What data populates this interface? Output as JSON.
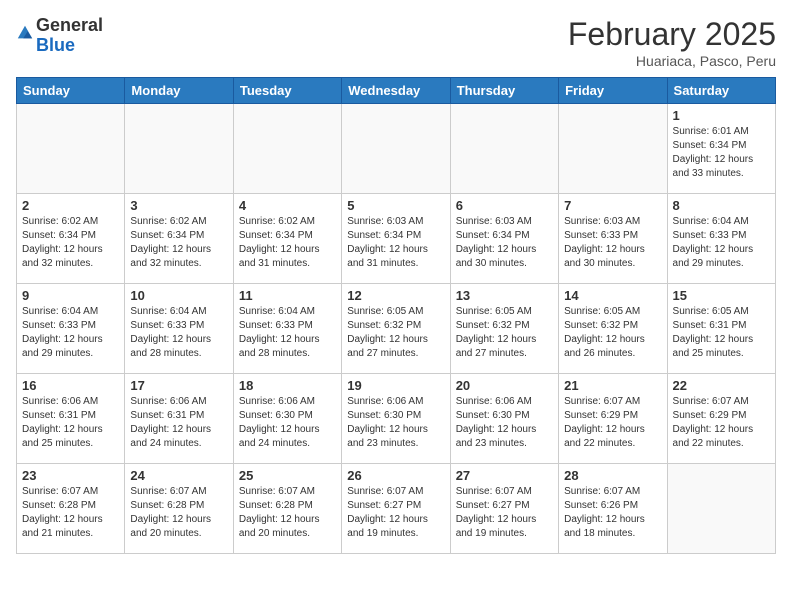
{
  "header": {
    "logo_general": "General",
    "logo_blue": "Blue",
    "month_title": "February 2025",
    "location": "Huariaca, Pasco, Peru"
  },
  "weekdays": [
    "Sunday",
    "Monday",
    "Tuesday",
    "Wednesday",
    "Thursday",
    "Friday",
    "Saturday"
  ],
  "weeks": [
    [
      {
        "day": "",
        "info": ""
      },
      {
        "day": "",
        "info": ""
      },
      {
        "day": "",
        "info": ""
      },
      {
        "day": "",
        "info": ""
      },
      {
        "day": "",
        "info": ""
      },
      {
        "day": "",
        "info": ""
      },
      {
        "day": "1",
        "info": "Sunrise: 6:01 AM\nSunset: 6:34 PM\nDaylight: 12 hours\nand 33 minutes."
      }
    ],
    [
      {
        "day": "2",
        "info": "Sunrise: 6:02 AM\nSunset: 6:34 PM\nDaylight: 12 hours\nand 32 minutes."
      },
      {
        "day": "3",
        "info": "Sunrise: 6:02 AM\nSunset: 6:34 PM\nDaylight: 12 hours\nand 32 minutes."
      },
      {
        "day": "4",
        "info": "Sunrise: 6:02 AM\nSunset: 6:34 PM\nDaylight: 12 hours\nand 31 minutes."
      },
      {
        "day": "5",
        "info": "Sunrise: 6:03 AM\nSunset: 6:34 PM\nDaylight: 12 hours\nand 31 minutes."
      },
      {
        "day": "6",
        "info": "Sunrise: 6:03 AM\nSunset: 6:34 PM\nDaylight: 12 hours\nand 30 minutes."
      },
      {
        "day": "7",
        "info": "Sunrise: 6:03 AM\nSunset: 6:33 PM\nDaylight: 12 hours\nand 30 minutes."
      },
      {
        "day": "8",
        "info": "Sunrise: 6:04 AM\nSunset: 6:33 PM\nDaylight: 12 hours\nand 29 minutes."
      }
    ],
    [
      {
        "day": "9",
        "info": "Sunrise: 6:04 AM\nSunset: 6:33 PM\nDaylight: 12 hours\nand 29 minutes."
      },
      {
        "day": "10",
        "info": "Sunrise: 6:04 AM\nSunset: 6:33 PM\nDaylight: 12 hours\nand 28 minutes."
      },
      {
        "day": "11",
        "info": "Sunrise: 6:04 AM\nSunset: 6:33 PM\nDaylight: 12 hours\nand 28 minutes."
      },
      {
        "day": "12",
        "info": "Sunrise: 6:05 AM\nSunset: 6:32 PM\nDaylight: 12 hours\nand 27 minutes."
      },
      {
        "day": "13",
        "info": "Sunrise: 6:05 AM\nSunset: 6:32 PM\nDaylight: 12 hours\nand 27 minutes."
      },
      {
        "day": "14",
        "info": "Sunrise: 6:05 AM\nSunset: 6:32 PM\nDaylight: 12 hours\nand 26 minutes."
      },
      {
        "day": "15",
        "info": "Sunrise: 6:05 AM\nSunset: 6:31 PM\nDaylight: 12 hours\nand 25 minutes."
      }
    ],
    [
      {
        "day": "16",
        "info": "Sunrise: 6:06 AM\nSunset: 6:31 PM\nDaylight: 12 hours\nand 25 minutes."
      },
      {
        "day": "17",
        "info": "Sunrise: 6:06 AM\nSunset: 6:31 PM\nDaylight: 12 hours\nand 24 minutes."
      },
      {
        "day": "18",
        "info": "Sunrise: 6:06 AM\nSunset: 6:30 PM\nDaylight: 12 hours\nand 24 minutes."
      },
      {
        "day": "19",
        "info": "Sunrise: 6:06 AM\nSunset: 6:30 PM\nDaylight: 12 hours\nand 23 minutes."
      },
      {
        "day": "20",
        "info": "Sunrise: 6:06 AM\nSunset: 6:30 PM\nDaylight: 12 hours\nand 23 minutes."
      },
      {
        "day": "21",
        "info": "Sunrise: 6:07 AM\nSunset: 6:29 PM\nDaylight: 12 hours\nand 22 minutes."
      },
      {
        "day": "22",
        "info": "Sunrise: 6:07 AM\nSunset: 6:29 PM\nDaylight: 12 hours\nand 22 minutes."
      }
    ],
    [
      {
        "day": "23",
        "info": "Sunrise: 6:07 AM\nSunset: 6:28 PM\nDaylight: 12 hours\nand 21 minutes."
      },
      {
        "day": "24",
        "info": "Sunrise: 6:07 AM\nSunset: 6:28 PM\nDaylight: 12 hours\nand 20 minutes."
      },
      {
        "day": "25",
        "info": "Sunrise: 6:07 AM\nSunset: 6:28 PM\nDaylight: 12 hours\nand 20 minutes."
      },
      {
        "day": "26",
        "info": "Sunrise: 6:07 AM\nSunset: 6:27 PM\nDaylight: 12 hours\nand 19 minutes."
      },
      {
        "day": "27",
        "info": "Sunrise: 6:07 AM\nSunset: 6:27 PM\nDaylight: 12 hours\nand 19 minutes."
      },
      {
        "day": "28",
        "info": "Sunrise: 6:07 AM\nSunset: 6:26 PM\nDaylight: 12 hours\nand 18 minutes."
      },
      {
        "day": "",
        "info": ""
      }
    ]
  ]
}
